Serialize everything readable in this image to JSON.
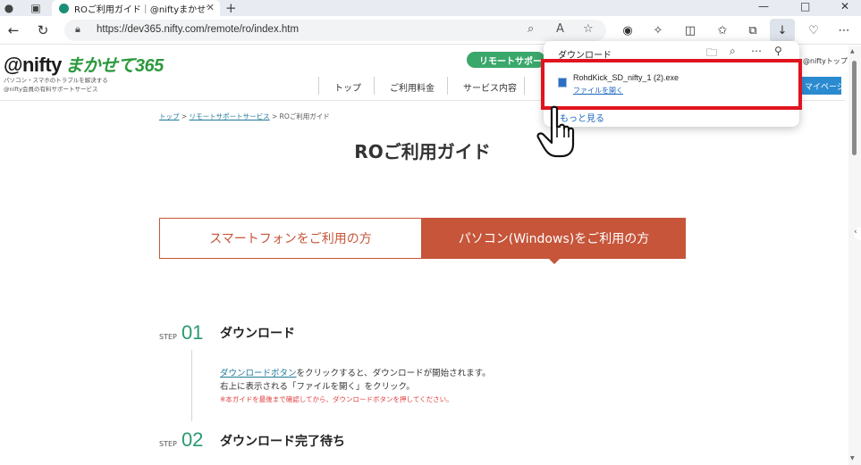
{
  "browser": {
    "tab": {
      "title": "ROご利用ガイド｜@niftyまかせて365"
    },
    "url": "https://dev365.nifty.com/remote/ro/index.htm",
    "window_controls": {
      "minimize": "—",
      "maximize": "□",
      "close": "✕"
    }
  },
  "site": {
    "logo": {
      "brand": "@nifty",
      "service": "まかせて365"
    },
    "tagline": [
      "パソコン・スマホのトラブルを解決する",
      "@nifty会員の有料サポートサービス"
    ],
    "remote_support_label": "リモートサポート",
    "nifty_top_label": "@niftyトップ",
    "mypage_label": "マイページ",
    "nav": [
      "トップ",
      "ご利用料金",
      "サービス内容"
    ]
  },
  "breadcrumb": {
    "items": [
      "トップ",
      "リモートサポートサービス"
    ],
    "current": "ROご利用ガイド",
    "sep": ">"
  },
  "page_title": "ROご利用ガイド",
  "device_tabs": {
    "smartphone": "スマートフォンをご利用の方",
    "pc": "パソコン(Windows)をご利用の方"
  },
  "steps": [
    {
      "label": "STEP",
      "number": "01",
      "title": "ダウンロード",
      "link": "ダウンロードボタン",
      "line1_rest": "をクリックすると、ダウンロードが開始されます。",
      "line2": "右上に表示される「ファイルを開く」をクリック。",
      "note": "※本ガイドを最後まで確認してから、ダウンロードボタンを押してください。"
    },
    {
      "label": "STEP",
      "number": "02",
      "title": "ダウンロード完了待ち"
    }
  ],
  "downloads": {
    "title": "ダウンロード",
    "file_name": "RohdKick_SD_nifty_1 (2).exe",
    "open_file": "ファイルを開く",
    "see_more": "もっと見る"
  },
  "colors": {
    "accent": "#c6553a",
    "green": "#2a9a6f",
    "highlight": "#e0141e",
    "link": "#1a66c2"
  }
}
